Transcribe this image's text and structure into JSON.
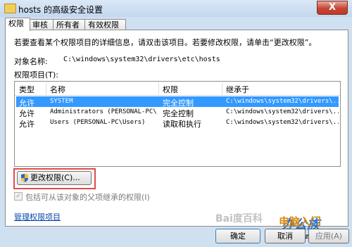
{
  "window": {
    "title": "hosts 的高级安全设置",
    "close_glyph": "X"
  },
  "tabs": [
    "权限",
    "审核",
    "所有者",
    "有效权限"
  ],
  "panel": {
    "description": "若要查看某个权限项目的详细信息，请双击该项目。若要修改权限，请单击“更改权限”。",
    "object_name_label": "对象名称:",
    "object_name_value": "C:\\windows\\system32\\drivers\\etc\\hosts",
    "permissions_label": "权限项目(T):",
    "columns": [
      "类型",
      "名称",
      "权限",
      "继承于"
    ],
    "rows": [
      {
        "type": "允许",
        "name": "SYSTEM",
        "perm": "完全控制",
        "inherit": "C:\\windows\\system32\\drivers\\...",
        "selected": true
      },
      {
        "type": "允许",
        "name": "Administrators (PERSONAL-PC\\...",
        "perm": "完全控制",
        "inherit": "C:\\windows\\system32\\drivers\\...",
        "selected": false
      },
      {
        "type": "允许",
        "name": "Users (PERSONAL-PC\\Users)",
        "perm": "读取和执行",
        "inherit": "C:\\windows\\system32\\drivers\\...",
        "selected": false
      }
    ],
    "change_button": "更改权限(C)...",
    "inherit_checkbox_label": "包括可从该对象的父项继承的权限(I)",
    "manage_link": "管理权限项目"
  },
  "footer": {
    "ok": "确定",
    "cancel": "取消",
    "apply": "应用(A)"
  },
  "watermark": {
    "line1": "办公族",
    "line2": "Officezu.com",
    "line3": "电脑入门",
    "line4": "Bai度百科"
  }
}
